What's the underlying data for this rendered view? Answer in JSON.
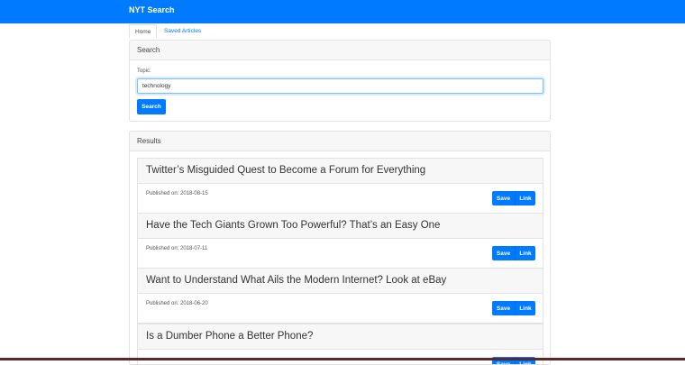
{
  "app": {
    "title": "NYT Search"
  },
  "tabs": [
    {
      "label": "Home",
      "active": true
    },
    {
      "label": "Saved Articles",
      "active": false
    }
  ],
  "search": {
    "header": "Search",
    "topic_label": "Topic:",
    "topic_value": "technology",
    "button_label": "Search"
  },
  "results": {
    "header": "Results",
    "published_prefix": "Published on:",
    "save_label": "Save",
    "link_label": "Link",
    "articles": [
      {
        "title": "Twitter’s Misguided Quest to Become a Forum for Everything",
        "published": "Published on: 2018-08-15"
      },
      {
        "title": "Have the Tech Giants Grown Too Powerful? That’s an Easy One",
        "published": "Published on: 2018-07-11"
      },
      {
        "title": "Want to Understand What Ails the Modern Internet? Look at eBay",
        "published": "Published on: 2018-06-20"
      },
      {
        "title": "Is a Dumber Phone a Better Phone?",
        "published": ""
      }
    ]
  },
  "colors": {
    "primary": "#007bff",
    "header_bg": "#f7f7f7",
    "border": "#e2e2e2"
  }
}
